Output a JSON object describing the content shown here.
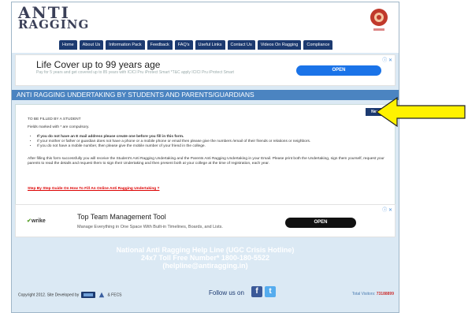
{
  "logo": {
    "line1": "ANTI",
    "line2": "RAGGING"
  },
  "nav": [
    "Home",
    "About Us",
    "Information Pack",
    "Feedback",
    "FAQ's",
    "Useful Links",
    "Contact Us",
    "Videos On Ragging",
    "Compliance"
  ],
  "ad_top": {
    "headline": "Life Cover up to 99 years age",
    "sub": "Pay for 5 years and get covered up to 85 years with ICICI Pru iProtect Smart *T&C apply ICICI Pru iProtect Smart",
    "button": "OPEN",
    "adchoice": "ⓘ ✕"
  },
  "section_title": "ANTI RAGGING UNDERTAKING BY STUDENTS AND PARENTS/GUARDIANS",
  "form": {
    "next_button": "Next",
    "heading": "TO BE FILLED BY A STUDENT",
    "mandatory": "Fields marked with * are compulsory.",
    "bullets": [
      "If you do not have an E mail address please create one before you fill in this form.",
      "If your mother or father or guardian does not have a phone or a mobile phone or email then please give the numbers /email of their friends or relations or neighbors.",
      "If you do not have a mobile number, then please give the mobile number of your friend in the college."
    ],
    "paragraph": "After filling this form successfully you will receive the Student's Anti Ragging Undertaking and the Parents Anti Ragging Undertaking in your Email. Please print both the Undertaking, sign them yourself, request your parents to read the details and request them to sign their Undertaking and then present both at your college at the time of registration, each year.",
    "guide_link": "Step By Step Guide On How To Fill An Online Anti Ragging Undertaking ?"
  },
  "ad_bottom": {
    "brand": "wrike",
    "headline": "Top Team Management Tool",
    "sub": "Manage Everything in One Space With Built-in Timelines, Boards, and Lists.",
    "button": "OPEN",
    "adchoice": "ⓘ ✕"
  },
  "helpline": {
    "line1": "National Anti Ragging Help Line (UGC Crisis Hotline)",
    "line2": "24x7 Toll Free Number* 1800-180-5522",
    "line3": "(helpline@antiragging.in)"
  },
  "footer": {
    "copyright": "Copyright 2012. Site Developed by",
    "partner": "& FECS",
    "follow": "Follow us on",
    "visitors_label": "Total Visitors:",
    "visitors_value": "73188899"
  },
  "colors": {
    "nav": "#1c3a70",
    "section": "#4b84c1",
    "background": "#dbe9f4",
    "arrow": "#fff200"
  }
}
